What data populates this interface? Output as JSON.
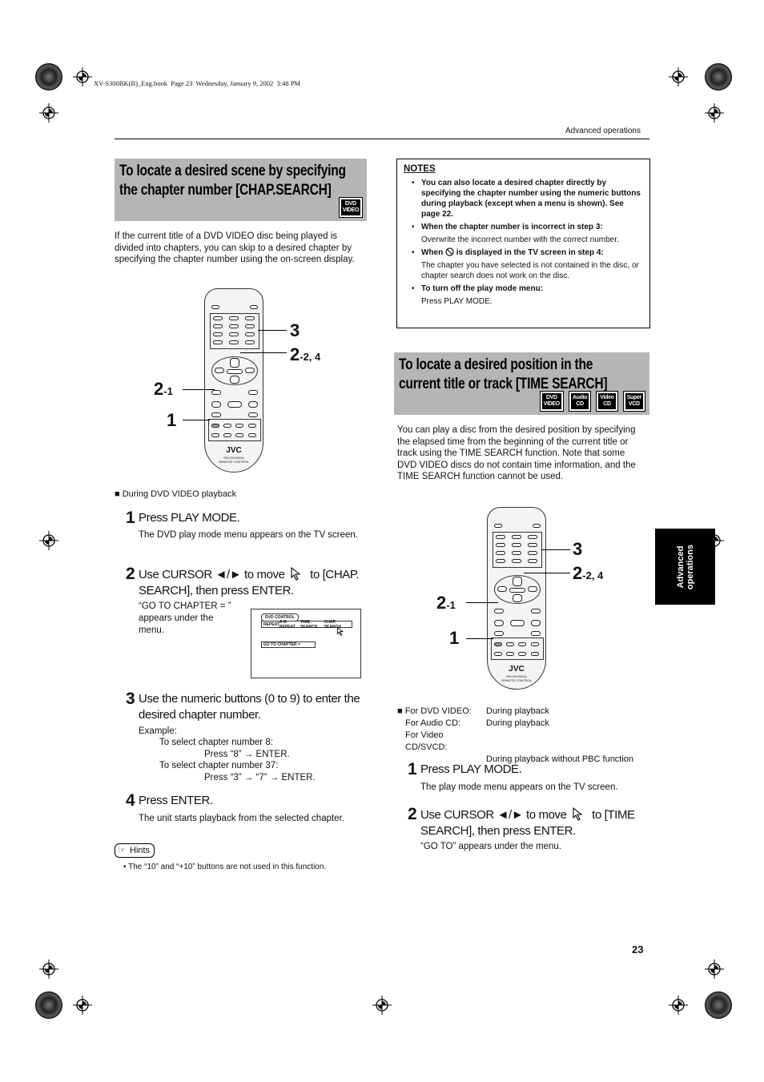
{
  "print_header": "XV-S300BK(B)_Eng.book  Page 23  Wednesday, January 9, 2002  3:48 PM",
  "running_head": "Advanced operations",
  "side_tab": {
    "line1": "Advanced",
    "line2": "operations"
  },
  "page_number": "23",
  "left": {
    "title_line1": "To locate a desired scene by specifying",
    "title_line2": "the chapter number [CHAP.SEARCH]",
    "badges": [
      {
        "top": "DVD",
        "bottom": "VIDEO"
      }
    ],
    "intro": "If the current title of a DVD VIDEO disc being played is divided into chapters, you can skip to a desired chapter by specifying the chapter number using the on-screen display.",
    "callouts": {
      "c3": "3",
      "c2_2": "2",
      "c2_2_suffix": "-2, 4",
      "c2_1": "2",
      "c2_1_suffix": "-1",
      "c1": "1"
    },
    "remote": {
      "brand": "JVC",
      "model": "RM-SXVS61A",
      "label": "REMOTE CONTROL"
    },
    "condition": "■ During DVD VIDEO playback",
    "steps": [
      {
        "num": "1",
        "text": "Press PLAY MODE.",
        "sub": "The DVD play mode menu appears on the TV screen."
      },
      {
        "num": "2",
        "text_a": "Use CURSOR ◄/► to move",
        "text_b": "to [CHAP.",
        "text_c": "SEARCH], then press ENTER.",
        "sub": "“GO TO CHAPTER = ” appears under the menu."
      },
      {
        "num": "3",
        "text": "Use the numeric buttons (0 to 9) to enter the desired chapter number.",
        "example_label": "Example:",
        "ex1_label": "To select chapter number 8:",
        "ex1_press": "Press “8” → ENTER.",
        "ex2_label": "To select chapter number 37:",
        "ex2_press": "Press “3” → “7” → ENTER."
      },
      {
        "num": "4",
        "text": "Press ENTER.",
        "sub": "The unit starts playback from the selected chapter."
      }
    ],
    "osd": {
      "title": "DVD CONTROL",
      "menu": [
        "REPEAT",
        "A-B REPEAT",
        "TIME SEARCH",
        "CHAP. SEARCH"
      ],
      "field": "GO TO CHAPTER ="
    },
    "hints_label": "Hints",
    "hint": "The “10” and “+10” buttons are not used in this function."
  },
  "notes": {
    "heading": "NOTES",
    "items": [
      {
        "bold": "You can also locate a desired chapter directly by specifying the chapter number using the numeric buttons during playback (except when a menu is shown). See page 22.",
        "plain": ""
      },
      {
        "bold": "When the chapter number is incorrect in step 3:",
        "plain": "Overwrite the incorrect number with the correct number."
      },
      {
        "bold_a": "When",
        "bold_b": "is displayed in the TV screen in step 4:",
        "plain": "The chapter you have selected is not contained in the disc, or chapter search does not work on the disc."
      },
      {
        "bold": "To turn off the play mode menu:",
        "plain": "Press PLAY MODE."
      }
    ]
  },
  "right": {
    "title_line1": "To locate a desired position in the",
    "title_line2": "current title or track [TIME SEARCH]",
    "badges": [
      {
        "top": "DVD",
        "bottom": "VIDEO"
      },
      {
        "top": "Audio",
        "bottom": "CD"
      },
      {
        "top": "Video",
        "bottom": "CD"
      },
      {
        "top": "Super",
        "bottom": "VCD"
      }
    ],
    "intro": "You can play a disc from the desired position by specifying the elapsed time from the beginning of the current title or track using the TIME SEARCH function. Note that some DVD VIDEO discs do not contain time information, and the TIME SEARCH function cannot be used.",
    "callouts": {
      "c3": "3",
      "c2_2": "2",
      "c2_2_suffix": "-2, 4",
      "c2_1": "2",
      "c2_1_suffix": "-1",
      "c1": "1"
    },
    "remote": {
      "brand": "JVC",
      "model": "RM-SXVS61A",
      "label": "REMOTE CONTROL"
    },
    "conditions": [
      {
        "disc": "■ For DVD VIDEO:",
        "when": "During playback"
      },
      {
        "disc": "For Audio CD:",
        "when": "During playback"
      },
      {
        "disc": "For Video CD/SVCD:",
        "when": ""
      },
      {
        "disc": "",
        "when": "During playback without PBC function"
      }
    ],
    "steps": [
      {
        "num": "1",
        "text": "Press PLAY MODE.",
        "sub": "The play mode menu appears on the TV screen."
      },
      {
        "num": "2",
        "text_a": "Use CURSOR ◄/► to move",
        "text_b": "to [TIME",
        "text_c": "SEARCH],  then press ENTER.",
        "sub": "“GO TO” appears under the menu."
      }
    ]
  }
}
